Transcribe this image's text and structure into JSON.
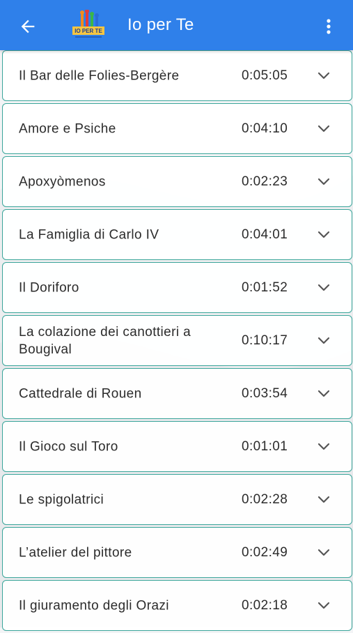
{
  "appbar": {
    "title": "Io per Te",
    "back_icon": "arrow-back-icon",
    "menu_icon": "more-vert-icon",
    "logo_text": "IO PER TE",
    "accent_color": "#2f80ea"
  },
  "tracks": [
    {
      "title": "Il Bar delle Folies-Bergère",
      "duration": "0:05:05"
    },
    {
      "title": "Amore e Psiche",
      "duration": "0:04:10"
    },
    {
      "title": "Apoxyòmenos",
      "duration": "0:02:23"
    },
    {
      "title": "La Famiglia di Carlo IV",
      "duration": "0:04:01"
    },
    {
      "title": "Il Doriforo",
      "duration": "0:01:52"
    },
    {
      "title": "La colazione dei canottieri a Bougival",
      "duration": "0:10:17"
    },
    {
      "title": "Cattedrale di Rouen",
      "duration": "0:03:54"
    },
    {
      "title": "Il Gioco sul Toro",
      "duration": "0:01:01"
    },
    {
      "title": "Le spigolatrici",
      "duration": "0:02:28"
    },
    {
      "title": "L’atelier del pittore",
      "duration": "0:02:49"
    },
    {
      "title": "Il giuramento degli Orazi",
      "duration": "0:02:18"
    }
  ],
  "row_border_color": "#3aa59a"
}
